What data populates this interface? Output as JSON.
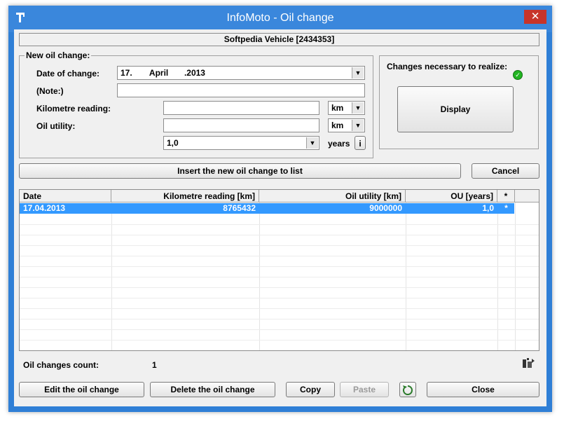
{
  "window": {
    "title": "InfoMoto - Oil change",
    "close_label": "✕"
  },
  "vehicle_header": "Softpedia Vehicle [2434353]",
  "new_oil_change": {
    "group_label": "New oil change:",
    "date_label": "Date of change:",
    "date_day": "17.",
    "date_month": "April",
    "date_year": ".2013",
    "note_label": "(Note:)",
    "note_value": "",
    "km_label": "Kilometre reading:",
    "km_value": "",
    "km_unit": "km",
    "oil_utility_label": "Oil utility:",
    "oil_utility_value": "",
    "oil_utility_unit": "km",
    "years_value": "1,0",
    "years_label": "years",
    "info_button": "i"
  },
  "changes_panel": {
    "label": "Changes necessary to realize:",
    "display_button": "Display",
    "status_icon": "check-circle-icon",
    "status_color": "#22b522"
  },
  "actions": {
    "insert_button": "Insert the new oil change to list",
    "cancel_button": "Cancel"
  },
  "table": {
    "columns": [
      "Date",
      "Kilometre reading [km]",
      "Oil utility [km]",
      "OU [years]",
      "*"
    ],
    "rows": [
      [
        "17.04.2013",
        "8765432",
        "9000000",
        "1,0",
        "*"
      ]
    ]
  },
  "footer": {
    "count_label": "Oil changes count:",
    "count_value": "1",
    "edit_button": "Edit the oil change",
    "delete_button": "Delete the oil change",
    "copy_button": "Copy",
    "paste_button": "Paste",
    "close_button": "Close"
  },
  "colors": {
    "titlebar": "#3a87dc",
    "selection": "#3399ff",
    "close": "#c7342a"
  }
}
